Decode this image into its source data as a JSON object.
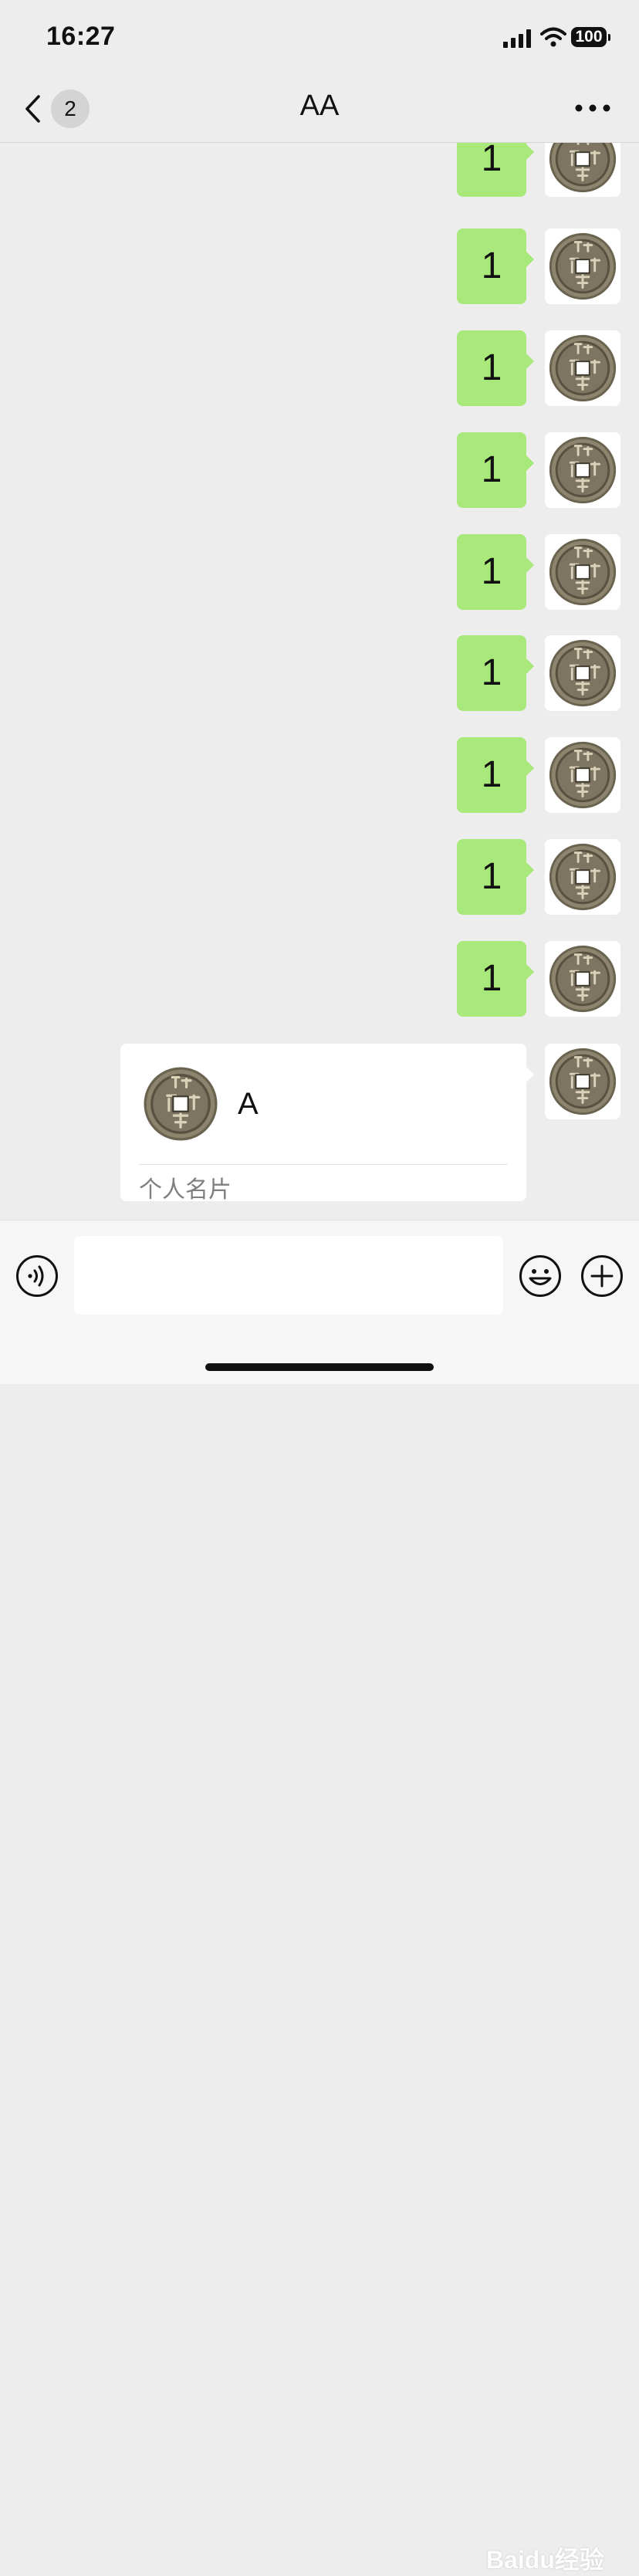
{
  "status_bar": {
    "time": "16:27",
    "battery": "100"
  },
  "nav": {
    "unread_count": "2",
    "title": "AA"
  },
  "messages": [
    {
      "text": "1"
    },
    {
      "text": "1"
    },
    {
      "text": "1"
    },
    {
      "text": "1"
    },
    {
      "text": "1"
    },
    {
      "text": "1"
    },
    {
      "text": "1"
    },
    {
      "text": "1"
    },
    {
      "text": "1"
    }
  ],
  "contact_card": {
    "name": "A",
    "footer": "个人名片"
  },
  "input": {
    "value": "",
    "placeholder": ""
  },
  "icons": {
    "back": "chevron-left-icon",
    "more": "more-dots-icon",
    "voice": "voice-icon",
    "emoji": "emoji-icon",
    "plus": "plus-icon",
    "avatar": "coin-avatar-icon"
  },
  "watermark": "Baidu经验",
  "colors": {
    "bubble": "#a9e87a",
    "background": "#ededed"
  }
}
